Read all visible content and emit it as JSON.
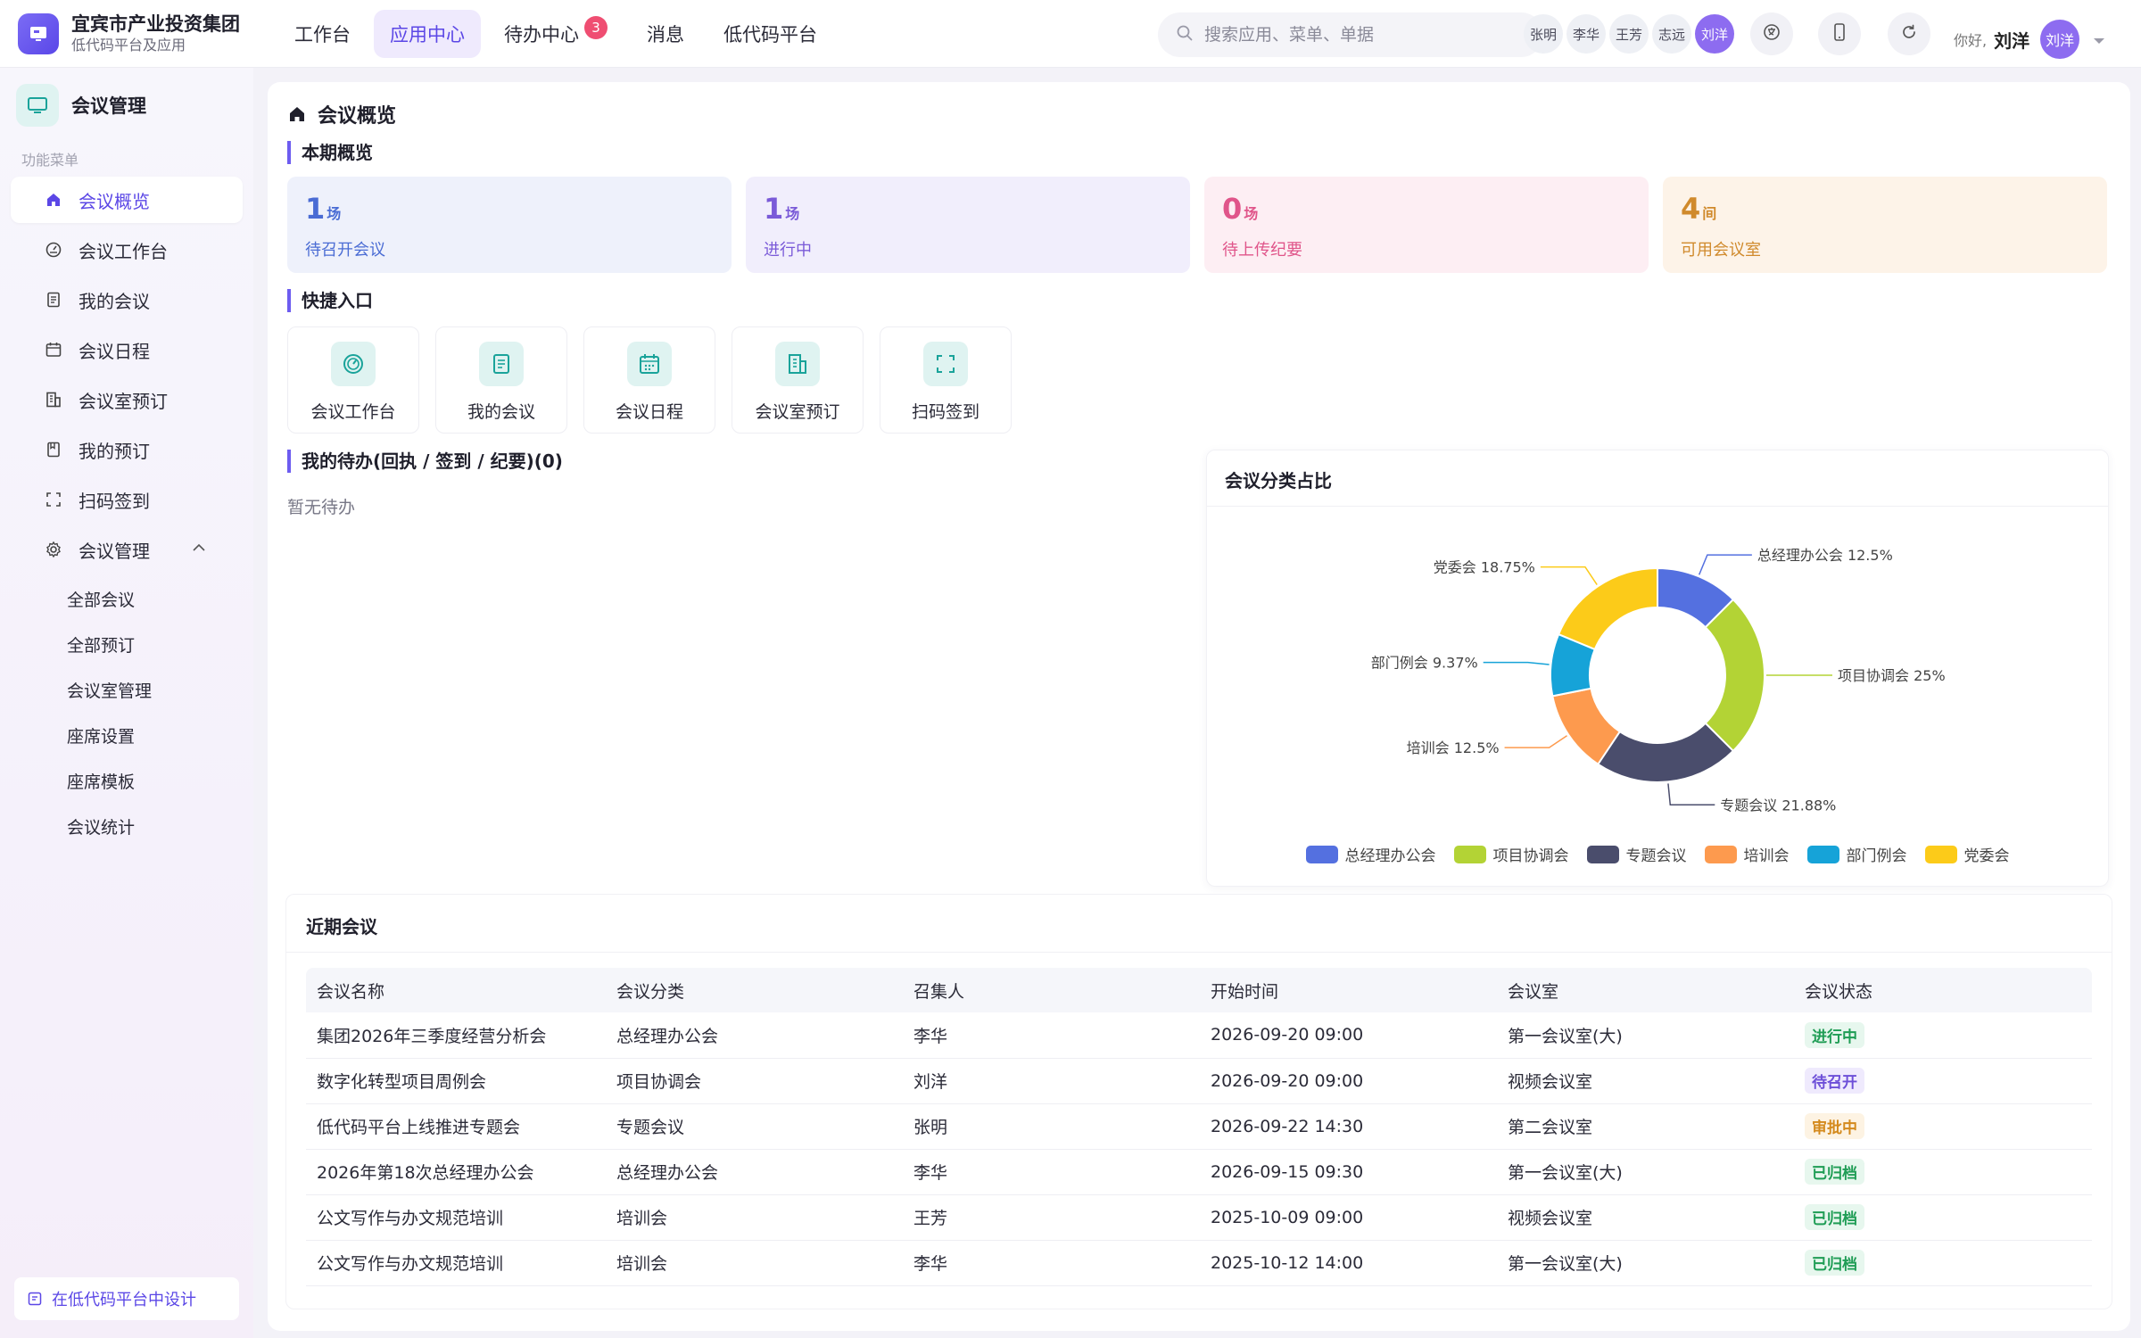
{
  "header": {
    "brand_title": "宜宾市产业投资集团",
    "brand_sub": "低代码平台及应用",
    "nav": [
      {
        "label": "工作台"
      },
      {
        "label": "应用中心"
      },
      {
        "label": "待办中心",
        "badge": "3"
      },
      {
        "label": "消息"
      },
      {
        "label": "低代码平台"
      }
    ],
    "search_placeholder": "搜索应用、菜单、单据",
    "users": [
      "张明",
      "李华",
      "王芳",
      "志远",
      "刘洋"
    ],
    "greeting": "你好,",
    "user_name": "刘洋",
    "avatar_text": "刘洋"
  },
  "sidebar": {
    "title": "会议管理",
    "section_label": "功能菜单",
    "items": [
      {
        "label": "会议概览",
        "icon": "home-icon"
      },
      {
        "label": "会议工作台",
        "icon": "dashboard-icon"
      },
      {
        "label": "我的会议",
        "icon": "document-icon"
      },
      {
        "label": "会议日程",
        "icon": "calendar-icon"
      },
      {
        "label": "会议室预订",
        "icon": "building-icon"
      },
      {
        "label": "我的预订",
        "icon": "bookmark-icon"
      },
      {
        "label": "扫码签到",
        "icon": "scan-icon"
      },
      {
        "label": "会议管理",
        "icon": "gear-icon"
      }
    ],
    "sub_items": [
      "全部会议",
      "全部预订",
      "会议室管理",
      "座席设置",
      "座席模板",
      "会议统计"
    ],
    "footer": "在低代码平台中设计"
  },
  "main": {
    "page_title": "会议概览",
    "overview_title": "本期概览",
    "stats": [
      {
        "value": "1",
        "unit": "场",
        "label": "待召开会议",
        "color": "#4a6cd4",
        "bg": "#eef1fb"
      },
      {
        "value": "1",
        "unit": "场",
        "label": "进行中",
        "color": "#7a5ad8",
        "bg": "#f1eefc"
      },
      {
        "value": "0",
        "unit": "场",
        "label": "待上传纪要",
        "color": "#e0558a",
        "bg": "#fdeef3"
      },
      {
        "value": "4",
        "unit": "间",
        "label": "可用会议室",
        "color": "#d08a2c",
        "bg": "#fdf3e8"
      }
    ],
    "quick_title": "快捷入口",
    "quick": [
      {
        "label": "会议工作台",
        "icon": "dashboard-icon"
      },
      {
        "label": "我的会议",
        "icon": "document-icon"
      },
      {
        "label": "会议日程",
        "icon": "calendar-icon"
      },
      {
        "label": "会议室预订",
        "icon": "building-icon"
      },
      {
        "label": "扫码签到",
        "icon": "scan-icon"
      }
    ],
    "todo_title": "我的待办(回执 / 签到 / 纪要)(0)",
    "todo_empty": "暂无待办",
    "recent_title": "近期会议",
    "table": {
      "headers": [
        "会议名称",
        "会议分类",
        "召集人",
        "开始时间",
        "会议室",
        "会议状态"
      ],
      "rows": [
        {
          "name": "集团2026年三季度经营分析会",
          "category": "总经理办公会",
          "host": "李华",
          "start": "2026-09-20 09:00",
          "room": "第一会议室(大)",
          "status": "进行中",
          "status_color": "#1f9d55",
          "status_bg": "#e7f7ee"
        },
        {
          "name": "数字化转型项目周例会",
          "category": "项目协调会",
          "host": "刘洋",
          "start": "2026-09-20 09:00",
          "room": "视频会议室",
          "status": "待召开",
          "status_color": "#6d4fd8",
          "status_bg": "#efeafd"
        },
        {
          "name": "低代码平台上线推进专题会",
          "category": "专题会议",
          "host": "张明",
          "start": "2026-09-22 14:30",
          "room": "第二会议室",
          "status": "审批中",
          "status_color": "#d48a1d",
          "status_bg": "#fdf3e3"
        },
        {
          "name": "2026年第18次总经理办公会",
          "category": "总经理办公会",
          "host": "李华",
          "start": "2026-09-15 09:30",
          "room": "第一会议室(大)",
          "status": "已归档",
          "status_color": "#1f9d55",
          "status_bg": "#e7f7ee"
        },
        {
          "name": "公文写作与办文规范培训",
          "category": "培训会",
          "host": "王芳",
          "start": "2025-10-09 09:00",
          "room": "视频会议室",
          "status": "已归档",
          "status_color": "#1f9d55",
          "status_bg": "#e7f7ee"
        },
        {
          "name": "公文写作与办文规范培训",
          "category": "培训会",
          "host": "李华",
          "start": "2025-10-12 14:00",
          "room": "第一会议室(大)",
          "status": "已归档",
          "status_color": "#1f9d55",
          "status_bg": "#e7f7ee"
        }
      ]
    }
  },
  "chart_data": {
    "type": "pie",
    "title": "会议分类占比",
    "donut": true,
    "legend_position": "bottom",
    "categories": [
      "总经理办公会",
      "项目协调会",
      "专题会议",
      "培训会",
      "部门例会",
      "党委会"
    ],
    "values": [
      12.5,
      25,
      21.88,
      12.5,
      9.37,
      18.75
    ],
    "labels": [
      "总经理办公会 12.5%",
      "项目协调会 25%",
      "专题会议 21.88%",
      "培训会 12.5%",
      "部门例会 9.37%",
      "党委会 18.75%"
    ],
    "colors": [
      "#5470e0",
      "#b3d335",
      "#4a4d6c",
      "#fd9a4e",
      "#16a3d8",
      "#fccb19"
    ]
  }
}
